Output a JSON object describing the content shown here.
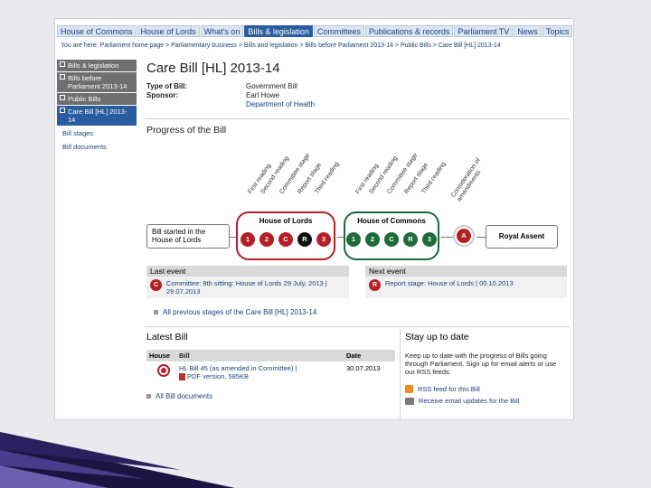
{
  "nav": {
    "tabs": [
      "House of Commons",
      "House of Lords",
      "What's on",
      "Bills & legislation",
      "Committees",
      "Publications & records",
      "Parliament TV",
      "News",
      "Topics"
    ],
    "active_index": 3
  },
  "breadcrumb": "You are here: Parliament home page > Parliamentary business > Bills and legislation > Bills before Parliament 2013-14 > Public Bills > Care Bill [HL] 2013-14",
  "sidebar": {
    "items": [
      "Bills & legislation",
      "Bills before Parliament 2013-14",
      "Public Bills",
      "Care Bill [HL] 2013-14"
    ],
    "active_index": 3,
    "links": [
      "Bill stages",
      "Bill documents"
    ]
  },
  "bill": {
    "title": "Care Bill [HL] 2013-14",
    "type_label": "Type of Bill:",
    "type_value": "Government Bill",
    "sponsor_label": "Sponsor:",
    "sponsor_name": "Earl Howe",
    "sponsor_dept": "Department of Health"
  },
  "progress": {
    "heading": "Progress of the Bill",
    "lords_stages": [
      "First reading",
      "Second reading",
      "Committee stage",
      "Report stage",
      "Third reading"
    ],
    "commons_stages": [
      "First reading",
      "Second reading",
      "Committee stage",
      "Report stage",
      "Third reading"
    ],
    "consideration_label": "Consideration of amendments",
    "start_box": "Bill started in the House of Lords",
    "lords_label": "House of Lords",
    "commons_label": "House of Commons",
    "stage_codes": [
      "1",
      "2",
      "C",
      "R",
      "3"
    ],
    "amendments_code": "A",
    "royal_assent": "Royal Assent"
  },
  "events": {
    "last_heading": "Last event",
    "last_code": "C",
    "last_text": "Committee: 8th sitting: House of Lords 29 July, 2013 | 29.07.2013",
    "next_heading": "Next event",
    "next_code": "R",
    "next_text": "Report stage: House of Lords | 00.10.2013",
    "all_previous": "All previous stages of the Care Bill [HL] 2013-14"
  },
  "latest_bill": {
    "heading": "Latest Bill",
    "columns": [
      "House",
      "Bill",
      "Date"
    ],
    "row": {
      "bill": "HL Bill 45 (as amended in Committee) |",
      "pdf": "PDF version, 585KB",
      "date": "30.07.2013"
    },
    "all_documents": "All Bill documents"
  },
  "stay": {
    "heading": "Stay up to date",
    "text": "Keep up to date with the progress of Bills going through Parliament. Sign up for email alerts or use our RSS feeds.",
    "rss": "RSS feed for this Bill",
    "email": "Receive email updates for the Bill"
  },
  "colors": {
    "lords": "#b42025",
    "commons": "#1e6b3a",
    "nav_active": "#2a5da0",
    "slide_decor": "#2b1f5e"
  }
}
